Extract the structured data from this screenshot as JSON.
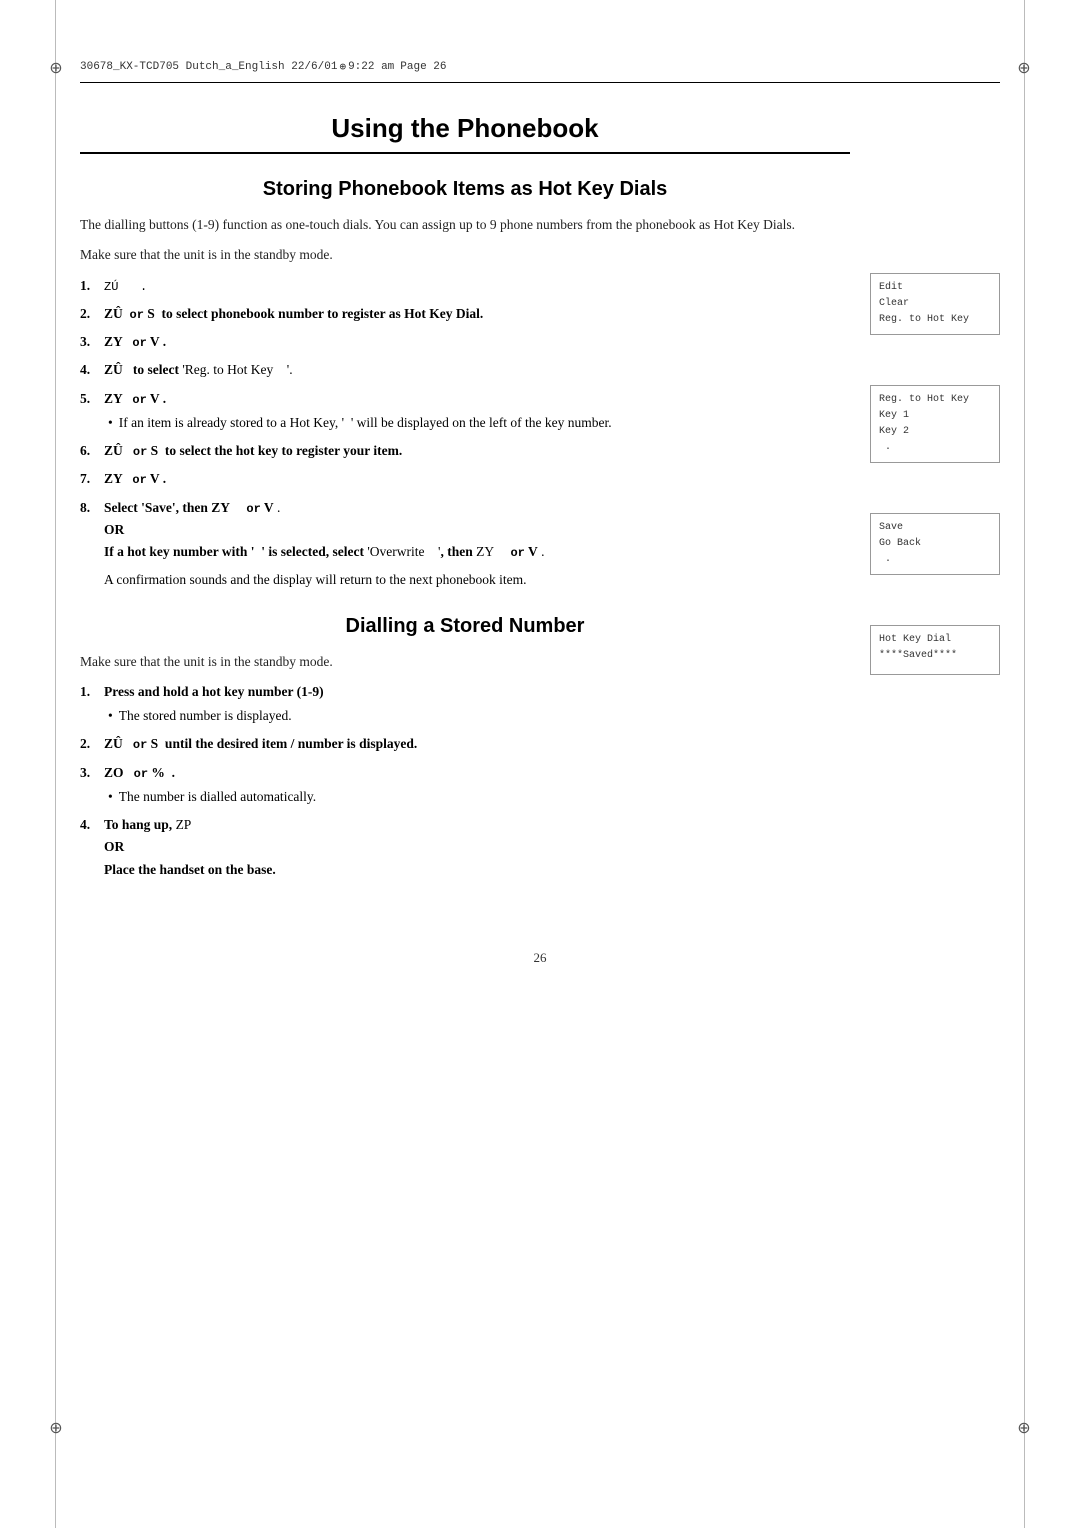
{
  "header": {
    "text": "30678_KX-TCD705  Dutch_a_English  22/6/01",
    "time": "9:22 am",
    "page_label": "Page  26"
  },
  "page_title": "Using the Phonebook",
  "section1": {
    "title": "Storing Phonebook Items as Hot Key Dials",
    "intro": [
      "The dialling buttons (1-9) function as one-touch dials. You can assign up to 9 phone numbers from the phonebook as Hot Key Dials.",
      "Make sure that the unit is in the standby mode."
    ],
    "steps": [
      {
        "num": "1.",
        "text_mono": "ZÚ  .",
        "text_bold": "",
        "text_plain": ""
      },
      {
        "num": "2.",
        "text_bold": "ZÛ  or S  to select phonebook number to register as Hot Key Dial."
      },
      {
        "num": "3.",
        "text_bold": "ZY  or V ."
      },
      {
        "num": "4.",
        "text_bold": "ZÛ  to select ",
        "text_plain": "'Reg. to Hot Key    '."
      },
      {
        "num": "5.",
        "text_bold": "ZY  or V .",
        "sub_bullet": "If an item is already stored to a Hot Key, '  ' will be displayed on the left of the key number."
      },
      {
        "num": "6.",
        "text_bold": "ZÛ  or S  to select the hot key to register your item."
      },
      {
        "num": "7.",
        "text_bold": "ZY  or V ."
      },
      {
        "num": "8.",
        "text_bold": "Select 'Save', then ZY",
        "text_bold2": "   or V",
        "text_plain": " .",
        "or_line": "OR",
        "conditional": "If a hot key number with '  ' is selected, select 'Overwrite    ', then ZY    or V .",
        "footer": "A confirmation sounds and the display will return to the next phonebook item."
      }
    ]
  },
  "section2": {
    "title": "Dialling a Stored Number",
    "intro": "Make sure that the unit is in the standby mode.",
    "steps": [
      {
        "num": "1.",
        "text_bold": "Press and hold a hot key number (1-9)",
        "sub_bullet": "The stored number is displayed."
      },
      {
        "num": "2.",
        "text_bold": "ZÛ  or S  until the desired item / number is displayed."
      },
      {
        "num": "3.",
        "text_bold": "ZO  or %  .",
        "sub_bullet": "The number is dialled automatically."
      },
      {
        "num": "4.",
        "text_plain": "To hang up, ZP",
        "or_line": "OR"
      }
    ],
    "hang_up": "To hang up, Z P",
    "place_handset": "Place the handset on the base."
  },
  "page_number": "26",
  "sidebar": {
    "box1": {
      "lines": [
        "Edit",
        "Clear",
        "Reg. to Hot Key"
      ]
    },
    "box2": {
      "lines": [
        "Reg. to Hot Key",
        "Key 1",
        "Key 2",
        " ."
      ]
    },
    "box3": {
      "lines": [
        "Save",
        "Go Back",
        " ."
      ]
    },
    "box4": {
      "lines": [
        "Hot Key Dial",
        "****Saved****"
      ]
    }
  }
}
